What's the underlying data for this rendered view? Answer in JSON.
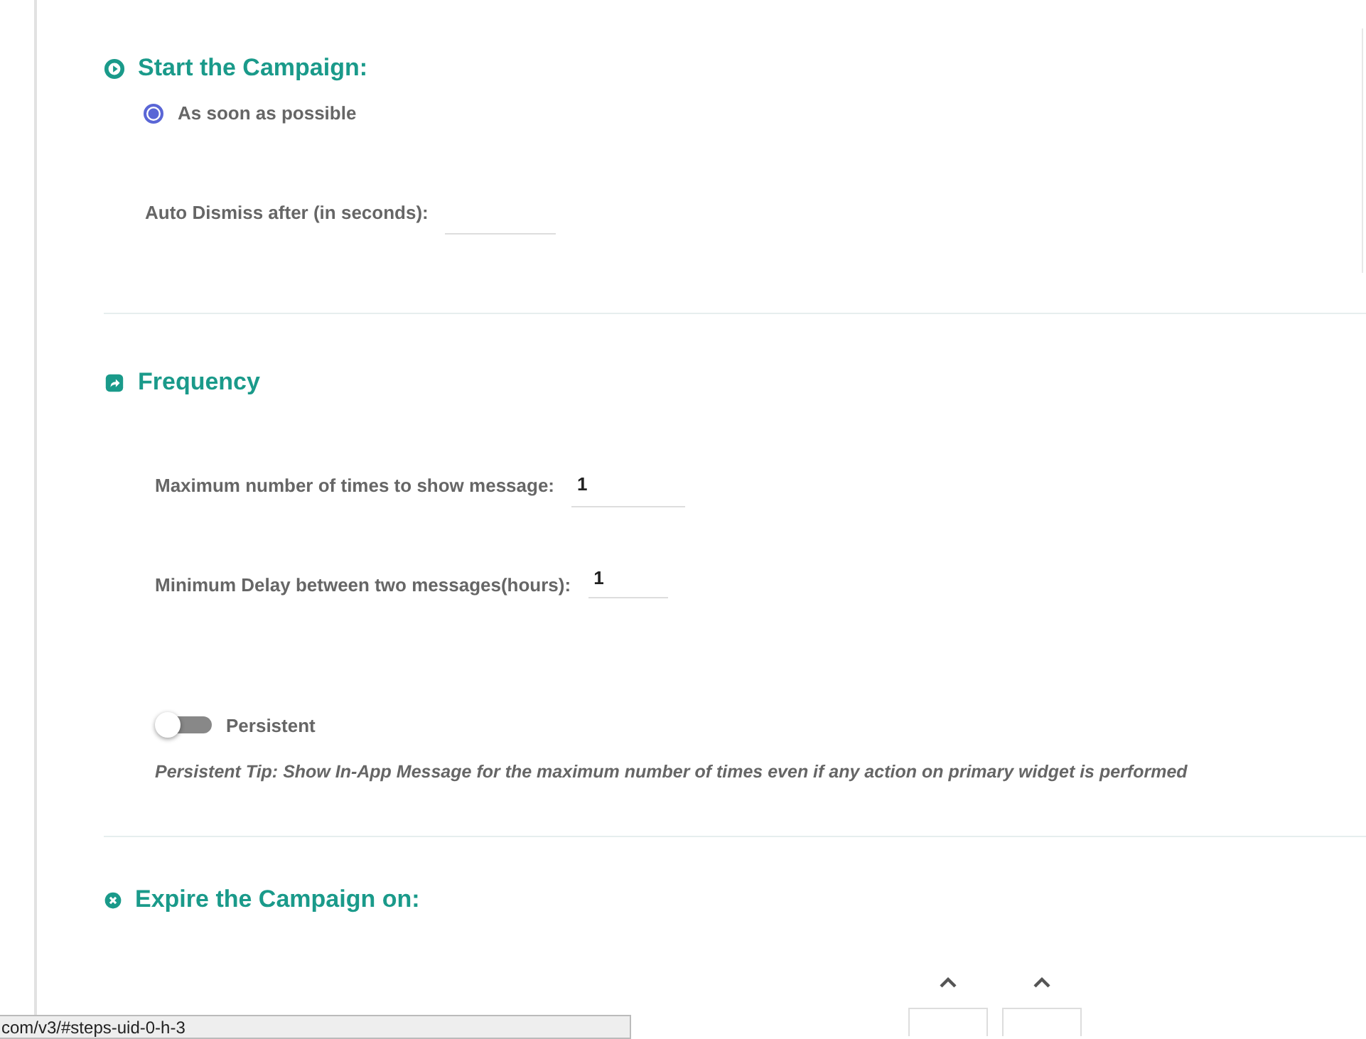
{
  "start": {
    "title": "Start the Campaign:",
    "options": [
      {
        "label": "As soon as possible",
        "selected": true
      }
    ],
    "auto_dismiss": {
      "label": "Auto Dismiss after (in seconds):"
    }
  },
  "frequency": {
    "title": "Frequency",
    "fields": [
      {
        "label": "Maximum number of times to show message:",
        "value": "1"
      },
      {
        "label": "Minimum Delay between two messages(hours):",
        "value": "1"
      }
    ],
    "persistent": {
      "label": "Persistent",
      "on": false
    },
    "tip": "Persistent Tip: Show In-App Message for the maximum number of times even if any action on primary widget is performed"
  },
  "expire": {
    "title": "Expire the Campaign on:"
  },
  "status_bar": {
    "url": "com/v3/#steps-uid-0-h-3"
  }
}
